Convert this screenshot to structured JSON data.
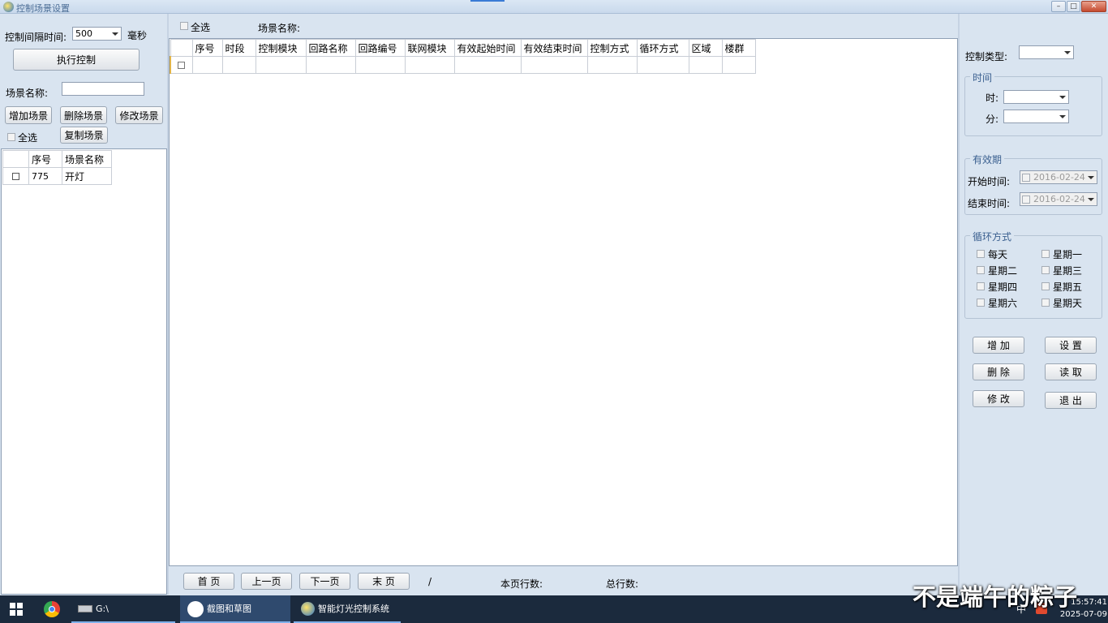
{
  "window": {
    "title": "控制场景设置",
    "min_icon": "minimize-icon",
    "max_icon": "maximize-icon",
    "close_icon": "close-icon"
  },
  "left": {
    "interval_label": "控制间隔时间:",
    "interval_value": "500",
    "interval_unit": "毫秒",
    "execute_button": "执行控制",
    "scene_name_label": "场景名称:",
    "scene_name_value": "",
    "add_button": "增加场景",
    "delete_button": "删除场景",
    "modify_button": "修改场景",
    "select_all": "全选",
    "copy_button": "复制场景",
    "table": {
      "headers": [
        "",
        "序号",
        "场景名称"
      ],
      "rows": [
        {
          "checked": false,
          "no": "775",
          "name": "开灯"
        }
      ]
    }
  },
  "middle": {
    "select_all": "全选",
    "scene_name_label": "场景名称:",
    "scene_name_value": "",
    "headers": [
      "",
      "序号",
      "时段",
      "控制模块",
      "回路名称",
      "回路编号",
      "联网模块",
      "有效起始时间",
      "有效结束时间",
      "控制方式",
      "循环方式",
      "区域",
      "楼群"
    ],
    "pager": {
      "first": "首 页",
      "prev": "上一页",
      "next": "下一页",
      "last": "末 页",
      "page_sep": "/",
      "page_rows_label": "本页行数:",
      "total_rows_label": "总行数:"
    }
  },
  "right": {
    "control_type_label": "控制类型:",
    "control_type_value": "",
    "time_group": {
      "title": "时间",
      "hour_label": "时:",
      "hour_value": "",
      "minute_label": "分:",
      "minute_value": ""
    },
    "valid_group": {
      "title": "有效期",
      "start_label": "开始时间:",
      "start_value": "2016-02-24",
      "end_label": "结束时间:",
      "end_value": "2016-02-24"
    },
    "cycle_group": {
      "title": "循环方式",
      "options": [
        "每天",
        "星期一",
        "星期二",
        "星期三",
        "星期四",
        "星期五",
        "星期六",
        "星期天"
      ]
    },
    "buttons": {
      "add": "增 加",
      "set": "设 置",
      "delete": "删 除",
      "read": "读 取",
      "modify": "修 改",
      "exit": "退 出"
    }
  },
  "taskbar": {
    "start_icon": "windows-start-icon",
    "items": [
      {
        "label": "G:\\",
        "icon": "drive-icon"
      },
      {
        "label": "截图和草图",
        "icon": "snip-sketch-icon"
      },
      {
        "label": "智能灯光控制系统",
        "icon": "app-icon"
      }
    ],
    "ime": "中",
    "clock_time": "15:57:41",
    "clock_date": "2025-07-09"
  },
  "watermark": "不是端午的粽子"
}
